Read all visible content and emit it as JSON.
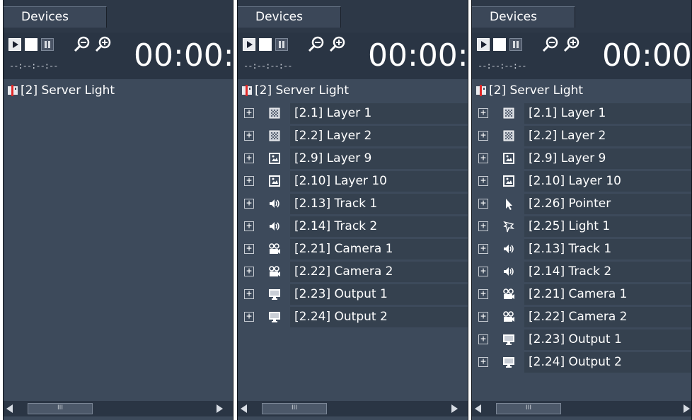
{
  "panels": [
    {
      "tab": "Devices",
      "timecode": "00:00:",
      "subtime": "--:--:--:--",
      "root": "[2] Server Light",
      "items": []
    },
    {
      "tab": "Devices",
      "timecode": "00:00:",
      "subtime": "--:--:--:--",
      "root": "[2] Server Light",
      "items": [
        {
          "icon": "layer-pattern-icon",
          "label": "[2.1] Layer 1"
        },
        {
          "icon": "layer-pattern-icon",
          "label": "[2.2] Layer 2"
        },
        {
          "icon": "layer-image-icon",
          "label": "[2.9] Layer 9"
        },
        {
          "icon": "layer-image-icon",
          "label": "[2.10] Layer 10"
        },
        {
          "icon": "speaker-icon",
          "label": "[2.13] Track 1"
        },
        {
          "icon": "speaker-icon",
          "label": "[2.14] Track 2"
        },
        {
          "icon": "camera-icon",
          "label": "[2.21] Camera 1"
        },
        {
          "icon": "camera-icon",
          "label": "[2.22] Camera 2"
        },
        {
          "icon": "monitor-icon",
          "label": "[2.23] Output 1"
        },
        {
          "icon": "monitor-icon",
          "label": "[2.24] Output 2"
        }
      ]
    },
    {
      "tab": "Devices",
      "timecode": "00:00",
      "subtime": "--:--:--:--",
      "root": "[2] Server Light",
      "items": [
        {
          "icon": "layer-pattern-icon",
          "label": "[2.1] Layer 1"
        },
        {
          "icon": "layer-pattern-icon",
          "label": "[2.2] Layer 2"
        },
        {
          "icon": "layer-image-icon",
          "label": "[2.9] Layer 9"
        },
        {
          "icon": "layer-image-icon",
          "label": "[2.10] Layer 10"
        },
        {
          "icon": "pointer-icon",
          "label": "[2.26] Pointer"
        },
        {
          "icon": "light-icon",
          "label": "[2.25] Light 1"
        },
        {
          "icon": "speaker-icon",
          "label": "[2.13] Track 1"
        },
        {
          "icon": "speaker-icon",
          "label": "[2.14] Track 2"
        },
        {
          "icon": "camera-icon",
          "label": "[2.21] Camera 1"
        },
        {
          "icon": "camera-icon",
          "label": "[2.22] Camera 2"
        },
        {
          "icon": "monitor-icon",
          "label": "[2.23] Output 1"
        },
        {
          "icon": "monitor-icon",
          "label": "[2.24] Output 2"
        }
      ]
    }
  ],
  "expander_glyph": "+",
  "scroll_thumb_glyph": "III",
  "colors": {
    "panel_bg": "#3d4a5b",
    "toolbar_bg": "#2a3544",
    "row_highlight": "#35414f",
    "text": "#ffffff",
    "device_red": "#e02828"
  }
}
